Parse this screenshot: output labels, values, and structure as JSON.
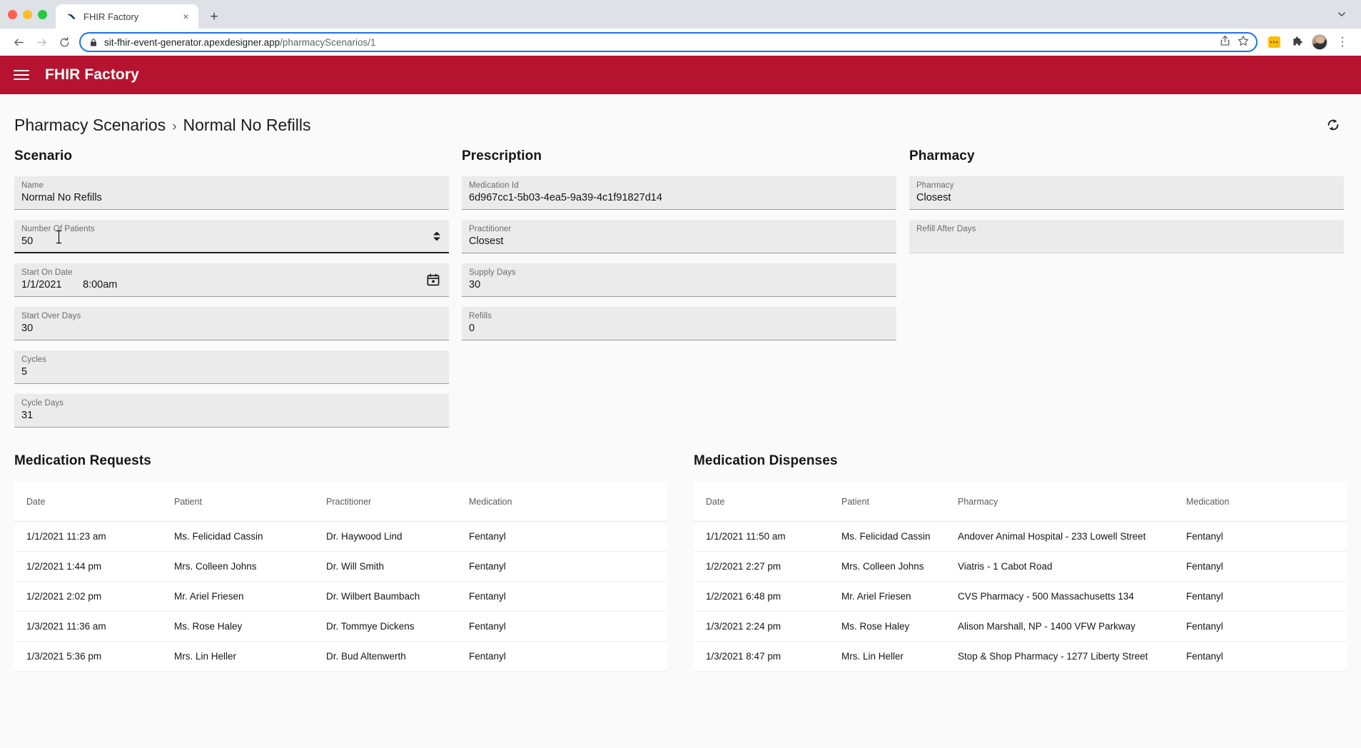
{
  "browser": {
    "tab": {
      "title": "FHIR Factory",
      "favicon": "bird-logo-icon",
      "close": "×"
    },
    "new_tab_label": "+",
    "nav": {
      "back": "←",
      "forward": "→",
      "reload": "⟳"
    },
    "omnibox": {
      "url_domain": "sit-fhir-event-generator.apexdesigner.app",
      "url_path": "/pharmacyScenarios/1",
      "lock": "lock-icon"
    },
    "actions": {
      "share": "share-icon",
      "bookmark": "star-icon",
      "extension": "extension-badge-icon",
      "puzzle": "puzzle-icon",
      "profile": "avatar",
      "menu": "⋮"
    },
    "tabstrip_chevron": "chevron-down-icon"
  },
  "app": {
    "title": "FHIR Factory",
    "accent_color": "#b5132f",
    "menu_icon": "hamburger-menu-icon"
  },
  "breadcrumb": {
    "parent": "Pharmacy Scenarios",
    "separator": "›",
    "current": "Normal No Refills"
  },
  "refresh_icon": "refresh-icon",
  "scenario": {
    "title": "Scenario",
    "fields": [
      {
        "label": "Name",
        "value": "Normal No Refills",
        "focused": false
      },
      {
        "label": "Number Of Patients",
        "value": "50",
        "focused": true,
        "trailing": "stepper"
      },
      {
        "label": "Start On Date",
        "value": "1/1/2021",
        "value2": "8:00am",
        "focused": false,
        "trailing": "calendar"
      },
      {
        "label": "Start Over Days",
        "value": "30",
        "focused": false
      },
      {
        "label": "Cycles",
        "value": "5",
        "focused": false
      },
      {
        "label": "Cycle Days",
        "value": "31",
        "focused": false
      }
    ]
  },
  "prescription": {
    "title": "Prescription",
    "fields": [
      {
        "label": "Medication Id",
        "value": "6d967cc1-5b03-4ea5-9a39-4c1f91827d14"
      },
      {
        "label": "Practitioner",
        "value": "Closest"
      },
      {
        "label": "Supply Days",
        "value": "30"
      },
      {
        "label": "Refills",
        "value": "0"
      }
    ]
  },
  "pharmacy": {
    "title": "Pharmacy",
    "fields": [
      {
        "label": "Pharmacy",
        "value": "Closest"
      },
      {
        "label": "Refill After Days",
        "value": ""
      }
    ]
  },
  "medication_requests": {
    "title": "Medication Requests",
    "columns": [
      "Date",
      "Patient",
      "Practitioner",
      "Medication"
    ],
    "rows": [
      [
        "1/1/2021 11:23 am",
        "Ms. Felicidad Cassin",
        "Dr. Haywood Lind",
        "Fentanyl"
      ],
      [
        "1/2/2021 1:44 pm",
        "Mrs. Colleen Johns",
        "Dr. Will Smith",
        "Fentanyl"
      ],
      [
        "1/2/2021 2:02 pm",
        "Mr. Ariel Friesen",
        "Dr. Wilbert Baumbach",
        "Fentanyl"
      ],
      [
        "1/3/2021 11:36 am",
        "Ms. Rose Haley",
        "Dr. Tommye Dickens",
        "Fentanyl"
      ],
      [
        "1/3/2021 5:36 pm",
        "Mrs. Lin Heller",
        "Dr. Bud Altenwerth",
        "Fentanyl"
      ]
    ]
  },
  "medication_dispenses": {
    "title": "Medication Dispenses",
    "columns": [
      "Date",
      "Patient",
      "Pharmacy",
      "Medication"
    ],
    "rows": [
      [
        "1/1/2021 11:50 am",
        "Ms. Felicidad Cassin",
        "Andover Animal Hospital - 233 Lowell Street",
        "Fentanyl"
      ],
      [
        "1/2/2021 2:27 pm",
        "Mrs. Colleen Johns",
        "Viatris - 1 Cabot Road",
        "Fentanyl"
      ],
      [
        "1/2/2021 6:48 pm",
        "Mr. Ariel Friesen",
        "CVS Pharmacy - 500 Massachusetts 134",
        "Fentanyl"
      ],
      [
        "1/3/2021 2:24 pm",
        "Ms. Rose Haley",
        "Alison Marshall, NP - 1400 VFW Parkway",
        "Fentanyl"
      ],
      [
        "1/3/2021 8:47 pm",
        "Mrs. Lin Heller",
        "Stop & Shop Pharmacy - 1277 Liberty Street",
        "Fentanyl"
      ]
    ]
  }
}
